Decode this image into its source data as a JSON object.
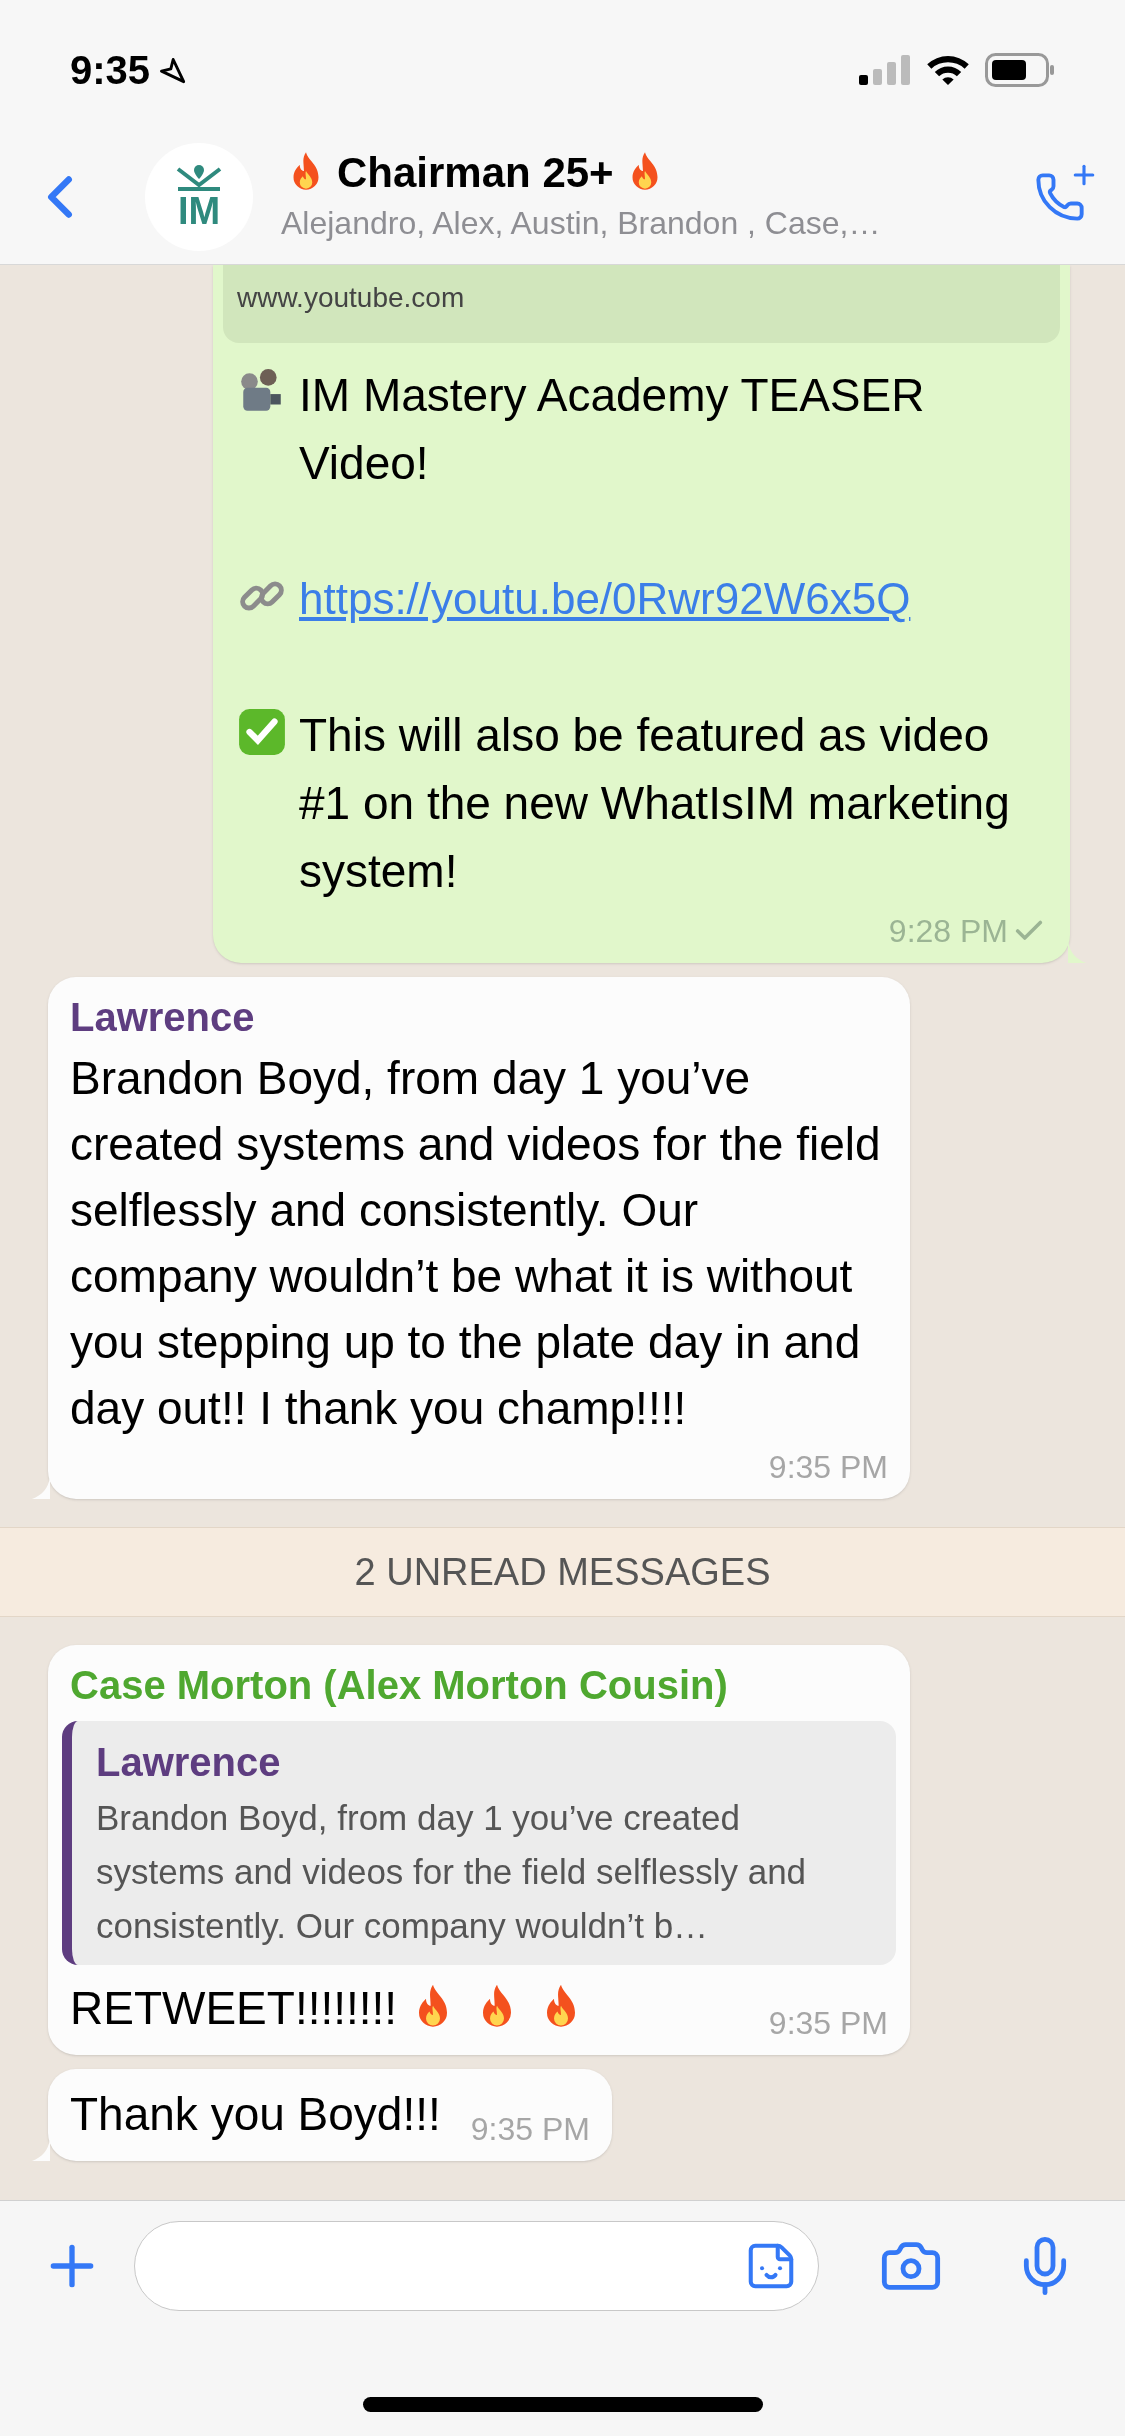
{
  "status_bar": {
    "time": "9:35"
  },
  "header": {
    "avatar_text": "IM",
    "title": "Chairman 25+",
    "subtitle": "Alejandro, Alex, Austin, Brandon , Case,…"
  },
  "messages": [
    {
      "kind": "outgoing",
      "tail": true,
      "preview_domain": "www.youtube.com",
      "paragraphs": [
        {
          "kind": "title",
          "text": "IM Mastery Academy TEASER Video!"
        },
        {
          "kind": "link",
          "text": "https://youtu.be/0Rwr92W6x5Q"
        },
        {
          "kind": "note",
          "text": "This will also be featured as video #1 on the new WhatIsIM marketing system!"
        }
      ],
      "time": "9:28 PM",
      "read": false
    },
    {
      "kind": "incoming",
      "tail": true,
      "sender": "Lawrence",
      "color": "#5e3d80",
      "text": "Brandon Boyd, from day 1 you’ve created systems and videos for the field selflessly and consistently. Our company wouldn’t be what it is without you stepping up to the plate day in and day out!! I thank you champ!!!!",
      "time": "9:35 PM"
    },
    {
      "kind": "divider",
      "text": "2 UNREAD MESSAGES"
    },
    {
      "kind": "incoming",
      "tail": false,
      "sender": "Case Morton (Alex Morton Cousin)",
      "color": "#4fa830",
      "quote": {
        "sender": "Lawrence",
        "color": "#5e3d80",
        "text": "Brandon Boyd, from day 1 you’ve created systems and videos for the field selflessly and consistently. Our company wouldn’t b…"
      },
      "text": "RETWEET!!!!!!!!",
      "trailing": [
        {
          "kind": "fire"
        },
        {
          "kind": "fire"
        },
        {
          "kind": "fire"
        }
      ],
      "time": "9:35 PM"
    },
    {
      "kind": "incoming",
      "tail": true,
      "text": "Thank you Boyd!!!",
      "time": "9:35 PM"
    }
  ]
}
